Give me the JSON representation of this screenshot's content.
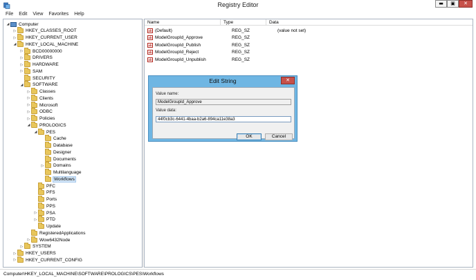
{
  "window": {
    "title": "Registry Editor",
    "minimize_glyph": "▬",
    "maximize_glyph": "▣",
    "close_glyph": "✕"
  },
  "menu": [
    "File",
    "Edit",
    "View",
    "Favorites",
    "Help"
  ],
  "tree": [
    {
      "label": "Computer",
      "indent": 0,
      "expander": "◢",
      "icon": "computer"
    },
    {
      "label": "HKEY_CLASSES_ROOT",
      "indent": 1,
      "expander": "▷",
      "icon": "folder"
    },
    {
      "label": "HKEY_CURRENT_USER",
      "indent": 1,
      "expander": "▷",
      "icon": "folder"
    },
    {
      "label": "HKEY_LOCAL_MACHINE",
      "indent": 1,
      "expander": "◢",
      "icon": "folder"
    },
    {
      "label": "BCD00000000",
      "indent": 2,
      "expander": "▷",
      "icon": "folder"
    },
    {
      "label": "DRIVERS",
      "indent": 2,
      "expander": "▷",
      "icon": "folder"
    },
    {
      "label": "HARDWARE",
      "indent": 2,
      "expander": "▷",
      "icon": "folder"
    },
    {
      "label": "SAM",
      "indent": 2,
      "expander": "▷",
      "icon": "folder"
    },
    {
      "label": "SECURITY",
      "indent": 2,
      "expander": "",
      "icon": "folder"
    },
    {
      "label": "SOFTWARE",
      "indent": 2,
      "expander": "◢",
      "icon": "folder"
    },
    {
      "label": "Classes",
      "indent": 3,
      "expander": "▷",
      "icon": "folder"
    },
    {
      "label": "Clients",
      "indent": 3,
      "expander": "▷",
      "icon": "folder"
    },
    {
      "label": "Microsoft",
      "indent": 3,
      "expander": "▷",
      "icon": "folder"
    },
    {
      "label": "ODBC",
      "indent": 3,
      "expander": "▷",
      "icon": "folder"
    },
    {
      "label": "Policies",
      "indent": 3,
      "expander": "▷",
      "icon": "folder"
    },
    {
      "label": "PROLOGICS",
      "indent": 3,
      "expander": "◢",
      "icon": "folder"
    },
    {
      "label": "PES",
      "indent": 4,
      "expander": "◢",
      "icon": "folder"
    },
    {
      "label": "Cache",
      "indent": 5,
      "expander": "",
      "icon": "folder"
    },
    {
      "label": "Database",
      "indent": 5,
      "expander": "",
      "icon": "folder"
    },
    {
      "label": "Designer",
      "indent": 5,
      "expander": "",
      "icon": "folder"
    },
    {
      "label": "Documents",
      "indent": 5,
      "expander": "",
      "icon": "folder"
    },
    {
      "label": "Domains",
      "indent": 5,
      "expander": "▷",
      "icon": "folder"
    },
    {
      "label": "Multilanguage",
      "indent": 5,
      "expander": "",
      "icon": "folder"
    },
    {
      "label": "Workflows",
      "indent": 5,
      "expander": "",
      "icon": "folder",
      "selected": true
    },
    {
      "label": "PFC",
      "indent": 4,
      "expander": "",
      "icon": "folder"
    },
    {
      "label": "PFS",
      "indent": 4,
      "expander": "",
      "icon": "folder"
    },
    {
      "label": "Ports",
      "indent": 4,
      "expander": "",
      "icon": "folder"
    },
    {
      "label": "PPS",
      "indent": 4,
      "expander": "",
      "icon": "folder"
    },
    {
      "label": "PSA",
      "indent": 4,
      "expander": "▷",
      "icon": "folder"
    },
    {
      "label": "PTD",
      "indent": 4,
      "expander": "▷",
      "icon": "folder"
    },
    {
      "label": "Update",
      "indent": 4,
      "expander": "",
      "icon": "folder"
    },
    {
      "label": "RegisteredApplications",
      "indent": 3,
      "expander": "",
      "icon": "folder"
    },
    {
      "label": "Wow6432Node",
      "indent": 3,
      "expander": "▷",
      "icon": "folder"
    },
    {
      "label": "SYSTEM",
      "indent": 2,
      "expander": "▷",
      "icon": "folder"
    },
    {
      "label": "HKEY_USERS",
      "indent": 1,
      "expander": "▷",
      "icon": "folder"
    },
    {
      "label": "HKEY_CURRENT_CONFIG",
      "indent": 1,
      "expander": "▷",
      "icon": "folder"
    }
  ],
  "list": {
    "columns": {
      "name": "Name",
      "type": "Type",
      "data": "Data"
    },
    "icon_text": "ab",
    "rows": [
      {
        "name": "(Default)",
        "type": "REG_SZ",
        "data": "(value not set)"
      },
      {
        "name": "ModelGroupId_Approve",
        "type": "REG_SZ",
        "data": ""
      },
      {
        "name": "ModelGroupId_Publish",
        "type": "REG_SZ",
        "data": ""
      },
      {
        "name": "ModelGroupId_Reject",
        "type": "REG_SZ",
        "data": ""
      },
      {
        "name": "ModelGroupId_Unpublish",
        "type": "REG_SZ",
        "data": ""
      }
    ]
  },
  "dialog": {
    "title": "Edit String",
    "close_glyph": "✕",
    "value_name_label": "Value name:",
    "value_name": "ModelGroupId_Approve",
    "value_data_label": "Value data:",
    "value_data": "44f0cb3c-6441-4baa-b2a6-894ca11e38a3",
    "ok_label": "OK",
    "cancel_label": "Cancel"
  },
  "statusbar": "Computer\\HKEY_LOCAL_MACHINE\\SOFTWARE\\PROLOGICS\\PES\\Workflows"
}
